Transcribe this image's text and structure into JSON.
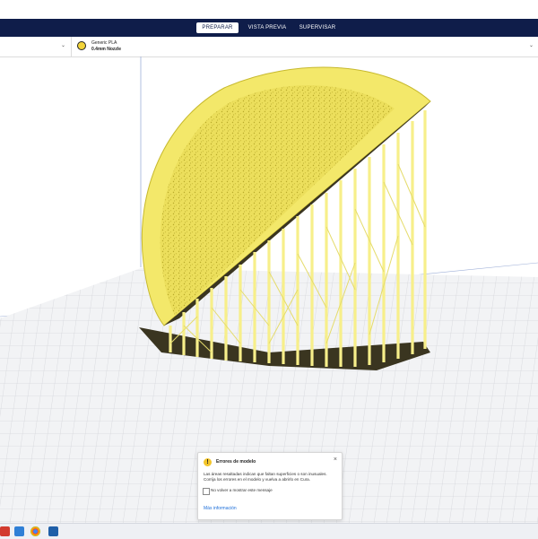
{
  "stages": {
    "prepare": "PREPARAR",
    "preview": "VISTA PREVIA",
    "monitor": "SUPERVISAR",
    "active": "prepare"
  },
  "settings": {
    "material_name": "Generic PLA",
    "nozzle": "0.4mm Nozzle",
    "material_color": "#f2d43a"
  },
  "dialog": {
    "title": "Errores de modelo",
    "body": "Las áreas resaltadas indican que faltan superficies o son inusuales. Corrija los errores en el modelo y vuelva a abrirlo en Cura.",
    "checkbox_label": "No volver a mostrar este mensaje",
    "checkbox_checked": false,
    "link": "Más información",
    "close_glyph": "×",
    "warning_glyph": "!"
  },
  "colors": {
    "navbar": "#0f1d4a",
    "model": "#f3e86a",
    "support": "#f7ef8a",
    "buildplate": "#f2f3f5",
    "grid": "#c9ccd2",
    "warning": "#f3c52b",
    "link": "#1e6fd9"
  },
  "taskbar": {
    "icons": [
      "app-red-icon",
      "file-explorer-icon",
      "chrome-icon",
      "cura-icon"
    ]
  }
}
